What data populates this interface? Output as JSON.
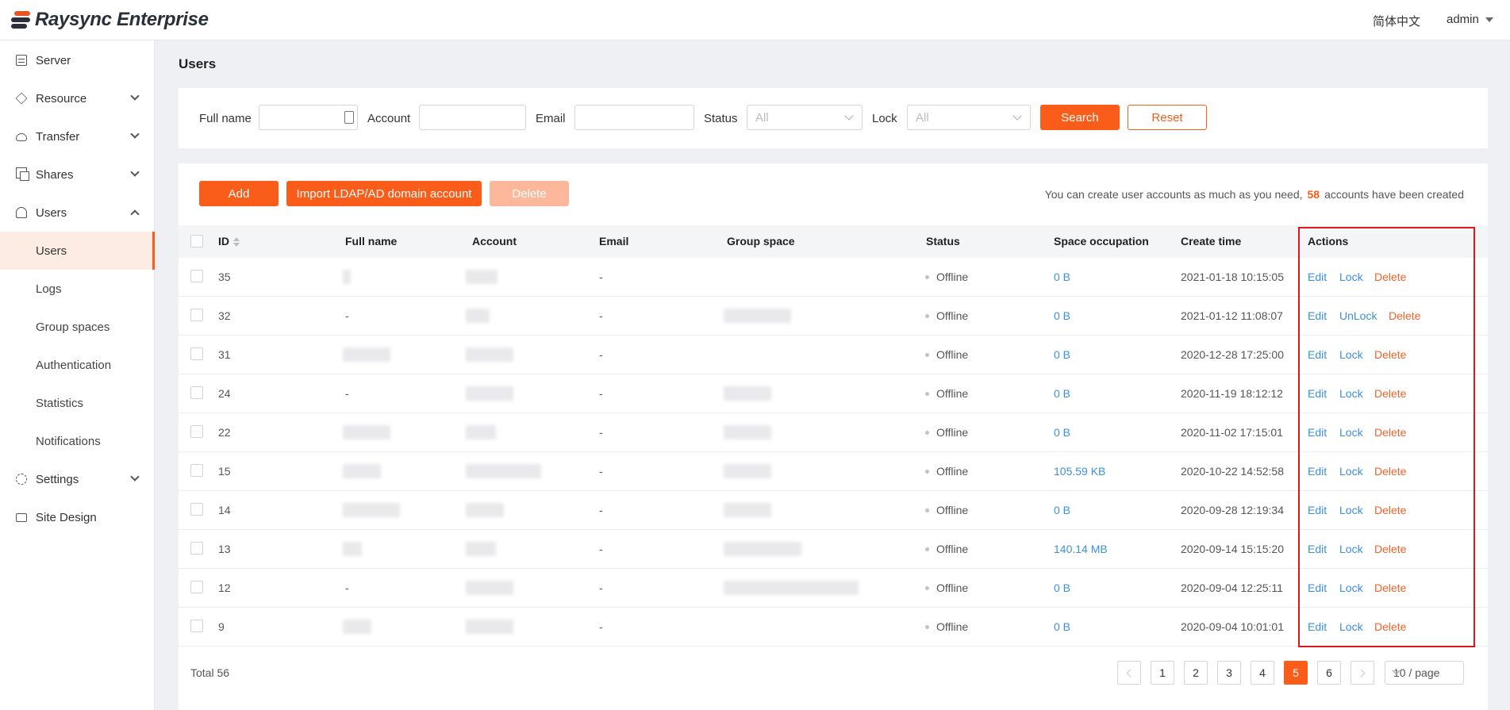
{
  "app": {
    "logo_text": "Raysync Enterprise",
    "language": "简体中文",
    "user": "admin"
  },
  "sidebar": {
    "items": [
      {
        "label": "Server",
        "icon": "server-icon"
      },
      {
        "label": "Resource",
        "icon": "layers-icon"
      },
      {
        "label": "Transfer",
        "icon": "cloud-icon"
      },
      {
        "label": "Shares",
        "icon": "share-icon"
      },
      {
        "label": "Users",
        "icon": "user-icon"
      },
      {
        "label": "Settings",
        "icon": "gear-icon"
      },
      {
        "label": "Site Design",
        "icon": "monitor-icon"
      }
    ],
    "sub_items": [
      "Users",
      "Logs",
      "Group spaces",
      "Authentication",
      "Statistics",
      "Notifications"
    ],
    "active_sub": "Users"
  },
  "page": {
    "title": "Users"
  },
  "filters": {
    "full_name_label": "Full name",
    "account_label": "Account",
    "email_label": "Email",
    "status_label": "Status",
    "status_placeholder": "All",
    "lock_label": "Lock",
    "lock_placeholder": "All",
    "search_label": "Search",
    "reset_label": "Reset"
  },
  "toolbar": {
    "add_label": "Add",
    "import_label": "Import LDAP/AD domain account",
    "delete_label": "Delete",
    "info_prefix": "You can create user accounts as much as you need,",
    "info_count": "58",
    "info_suffix": "accounts have been created"
  },
  "table": {
    "columns": [
      "ID",
      "Full name",
      "Account",
      "Email",
      "Group space",
      "Status",
      "Space occupation",
      "Create time",
      "Actions"
    ],
    "rows": [
      {
        "id": "35",
        "full_name": "",
        "email": "-",
        "status": "Offline",
        "space": "0 B",
        "created": "2021-01-18 10:15:05",
        "lock_action": "Lock"
      },
      {
        "id": "32",
        "full_name": "-",
        "email": "-",
        "status": "Offline",
        "space": "0 B",
        "created": "2021-01-12 11:08:07",
        "lock_action": "UnLock"
      },
      {
        "id": "31",
        "full_name": "",
        "email": "-",
        "status": "Offline",
        "space": "0 B",
        "created": "2020-12-28 17:25:00",
        "lock_action": "Lock"
      },
      {
        "id": "24",
        "full_name": "-",
        "email": "-",
        "status": "Offline",
        "space": "0 B",
        "created": "2020-11-19 18:12:12",
        "lock_action": "Lock"
      },
      {
        "id": "22",
        "full_name": "",
        "email": "-",
        "status": "Offline",
        "space": "0 B",
        "created": "2020-11-02 17:15:01",
        "lock_action": "Lock"
      },
      {
        "id": "15",
        "full_name": "",
        "email": "-",
        "status": "Offline",
        "space": "105.59 KB",
        "created": "2020-10-22 14:52:58",
        "lock_action": "Lock"
      },
      {
        "id": "14",
        "full_name": "",
        "email": "-",
        "status": "Offline",
        "space": "0 B",
        "created": "2020-09-28 12:19:34",
        "lock_action": "Lock"
      },
      {
        "id": "13",
        "full_name": "",
        "email": "-",
        "status": "Offline",
        "space": "140.14 MB",
        "created": "2020-09-14 15:15:20",
        "lock_action": "Lock"
      },
      {
        "id": "12",
        "full_name": "-",
        "email": "-",
        "status": "Offline",
        "space": "0 B",
        "created": "2020-09-04 12:25:11",
        "lock_action": "Lock"
      },
      {
        "id": "9",
        "full_name": "",
        "email": "-",
        "status": "Offline",
        "space": "0 B",
        "created": "2020-09-04 10:01:01",
        "lock_action": "Lock"
      }
    ],
    "edit_label": "Edit",
    "delete_label": "Delete"
  },
  "pagination": {
    "total_label": "Total 56",
    "pages": [
      "1",
      "2",
      "3",
      "4",
      "5",
      "6"
    ],
    "current": "5",
    "page_size_label": "10 / page"
  }
}
